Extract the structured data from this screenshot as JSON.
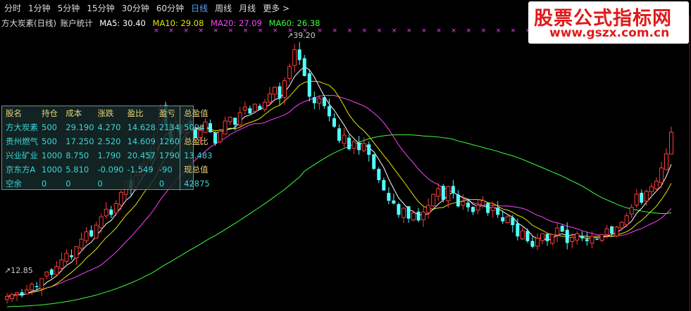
{
  "toolbar": {
    "items": [
      "分时",
      "1分钟",
      "5分钟",
      "15分钟",
      "30分钟",
      "60分钟",
      "日线",
      "周线",
      "月线",
      "更多 >"
    ],
    "active_index": 6
  },
  "title": {
    "name": "方大炭素(日线)",
    "indicator": "账户统计",
    "ma5": "MA5: 30.40",
    "ma10": "MA10: 29.08",
    "ma20": "MA20: 27.09",
    "ma60": "MA60: 26.38"
  },
  "colors": {
    "up": "#ff3c3c",
    "down": "#54ffff",
    "ma5": "#ffffff",
    "ma10": "#e6e600",
    "ma20": "#ff40ff",
    "ma60": "#3cff3c",
    "marker": "#ff40ff"
  },
  "logo": {
    "line1": "股票公式指标网",
    "line2": "www.gszx.com.cn"
  },
  "stats": {
    "headers": [
      "股名",
      "持仓",
      "成本",
      "涨跌",
      "盈比",
      "盈亏"
    ],
    "rows": [
      {
        "name": "方大炭素",
        "qty": "500",
        "cost": "29.190",
        "chg": "4.270",
        "ratio": "14.628",
        "pl": "2134"
      },
      {
        "name": "贵州燃气",
        "qty": "500",
        "cost": "17.250",
        "chg": "2.520",
        "ratio": "14.609",
        "pl": "1260"
      },
      {
        "name": "兴业矿业",
        "qty": "1000",
        "cost": "8.750",
        "chg": "1.790",
        "ratio": "20.457",
        "pl": "1790"
      },
      {
        "name": "京东方A",
        "qty": "1000",
        "cost": "5.810",
        "chg": "-0.090",
        "ratio": "-1.549",
        "pl": "-90"
      },
      {
        "name": "空余",
        "qty": "0",
        "cost": "0",
        "chg": "0",
        "ratio": "",
        "pl": "0"
      }
    ],
    "summary": [
      {
        "label": "总盈值",
        "value": "5094"
      },
      {
        "label": "总盈比",
        "value": "13.483"
      },
      {
        "label": "现总值",
        "value": "42875"
      }
    ]
  },
  "chart_data": {
    "type": "candlestick",
    "price_range": [
      11.5,
      41.5
    ],
    "max_label": "39.20",
    "min_label": "12.85",
    "closes": [
      12.9,
      13.1,
      13.3,
      13.0,
      13.6,
      14.2,
      13.9,
      14.8,
      15.5,
      15.2,
      16.1,
      16.8,
      17.5,
      17.1,
      18.2,
      19.0,
      19.8,
      19.3,
      20.5,
      21.4,
      22.2,
      21.6,
      22.8,
      24.0,
      25.1,
      24.4,
      25.8,
      27.0,
      28.2,
      27.5,
      30.8,
      33.0,
      31.2,
      29.6,
      31.5,
      30.2,
      31.8,
      31.0,
      29.8,
      30.6,
      31.5,
      30.4,
      29.2,
      30.5,
      31.6,
      32.0,
      31.2,
      32.5,
      33.1,
      32.4,
      33.4,
      32.8,
      33.6,
      34.5,
      35.2,
      34.0,
      35.9,
      37.4,
      39.2,
      38.1,
      36.4,
      34.2,
      33.5,
      34.0,
      33.2,
      32.1,
      31.0,
      29.5,
      30.1,
      28.6,
      29.4,
      28.5,
      29.2,
      28.0,
      26.5,
      25.3,
      24.2,
      23.1,
      22.8,
      21.6,
      22.3,
      21.2,
      21.8,
      21.0,
      21.9,
      22.6,
      23.8,
      24.4,
      23.2,
      24.6,
      23.9,
      22.5,
      23.0,
      22.4,
      21.9,
      22.6,
      23.1,
      21.8,
      22.4,
      21.6,
      20.9,
      21.4,
      20.5,
      19.3,
      19.9,
      18.8,
      18.2,
      19.1,
      19.6,
      18.8,
      19.5,
      20.2,
      19.8,
      18.6,
      19.2,
      19.6,
      19.1,
      18.8,
      19.3,
      19.0,
      19.5,
      20.1,
      19.6,
      20.3,
      20.8,
      21.5,
      22.4,
      23.8,
      22.9,
      24.1,
      24.6,
      25.2,
      26.6,
      28.1,
      30.4
    ],
    "ma20_end": 27.09,
    "ma60_end": 26.38,
    "ma5_end": 30.4,
    "ma10_end": 29.08
  }
}
